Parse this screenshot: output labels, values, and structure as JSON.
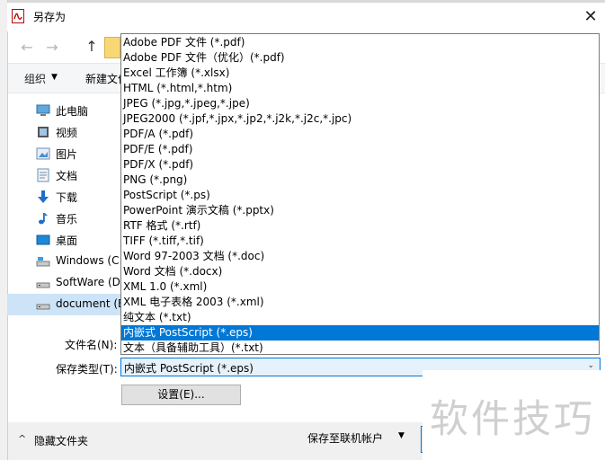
{
  "window": {
    "title": "另存为",
    "close_glyph": "✕"
  },
  "nav": {
    "back_glyph": "←",
    "forward_glyph": "→",
    "up_glyph": "↑"
  },
  "toolbar": {
    "organize_label": "组织",
    "organize_arrow": "▼",
    "new_folder_label": "新建文件"
  },
  "sidebar": {
    "items": [
      {
        "label": "此电脑",
        "icon": "computer-icon"
      },
      {
        "label": "视频",
        "icon": "video-icon"
      },
      {
        "label": "图片",
        "icon": "picture-icon"
      },
      {
        "label": "文档",
        "icon": "document-icon"
      },
      {
        "label": "下载",
        "icon": "download-icon"
      },
      {
        "label": "音乐",
        "icon": "music-icon"
      },
      {
        "label": "桌面",
        "icon": "desktop-icon"
      },
      {
        "label": "Windows (C:",
        "icon": "drive-icon"
      },
      {
        "label": "SoftWare (D",
        "icon": "drive-icon"
      },
      {
        "label": "document (E",
        "icon": "drive-icon",
        "selected": true
      }
    ]
  },
  "file_types": {
    "options": [
      "Adobe PDF 文件 (*.pdf)",
      "Adobe PDF 文件（优化）(*.pdf)",
      "Excel 工作簿 (*.xlsx)",
      "HTML (*.html,*.htm)",
      "JPEG (*.jpg,*.jpeg,*.jpe)",
      "JPEG2000 (*.jpf,*.jpx,*.jp2,*.j2k,*.j2c,*.jpc)",
      "PDF/A (*.pdf)",
      "PDF/E (*.pdf)",
      "PDF/X (*.pdf)",
      "PNG (*.png)",
      "PostScript (*.ps)",
      "PowerPoint 演示文稿 (*.pptx)",
      "RTF 格式 (*.rtf)",
      "TIFF (*.tiff,*.tif)",
      "Word 97-2003 文档 (*.doc)",
      "Word 文档 (*.docx)",
      "XML 1.0 (*.xml)",
      "XML 电子表格 2003 (*.xml)",
      "纯文本 (*.txt)",
      "内嵌式 PostScript (*.eps)",
      "文本（具备辅助工具）(*.txt)"
    ],
    "highlighted_index": 19,
    "accent": "#0078d7"
  },
  "form": {
    "filename_label": "文件名(N):",
    "type_label": "保存类型(T):",
    "type_value": "内嵌式 PostScript (*.eps)",
    "type_arrow": "⌄",
    "settings_label": "设置(E)..."
  },
  "footer": {
    "hide_folders_label": "隐藏文件夹",
    "hide_arrow": "^",
    "save_online_label": "保存至联机帐户",
    "save_online_arrow": "▼"
  },
  "watermark": "软件技巧"
}
